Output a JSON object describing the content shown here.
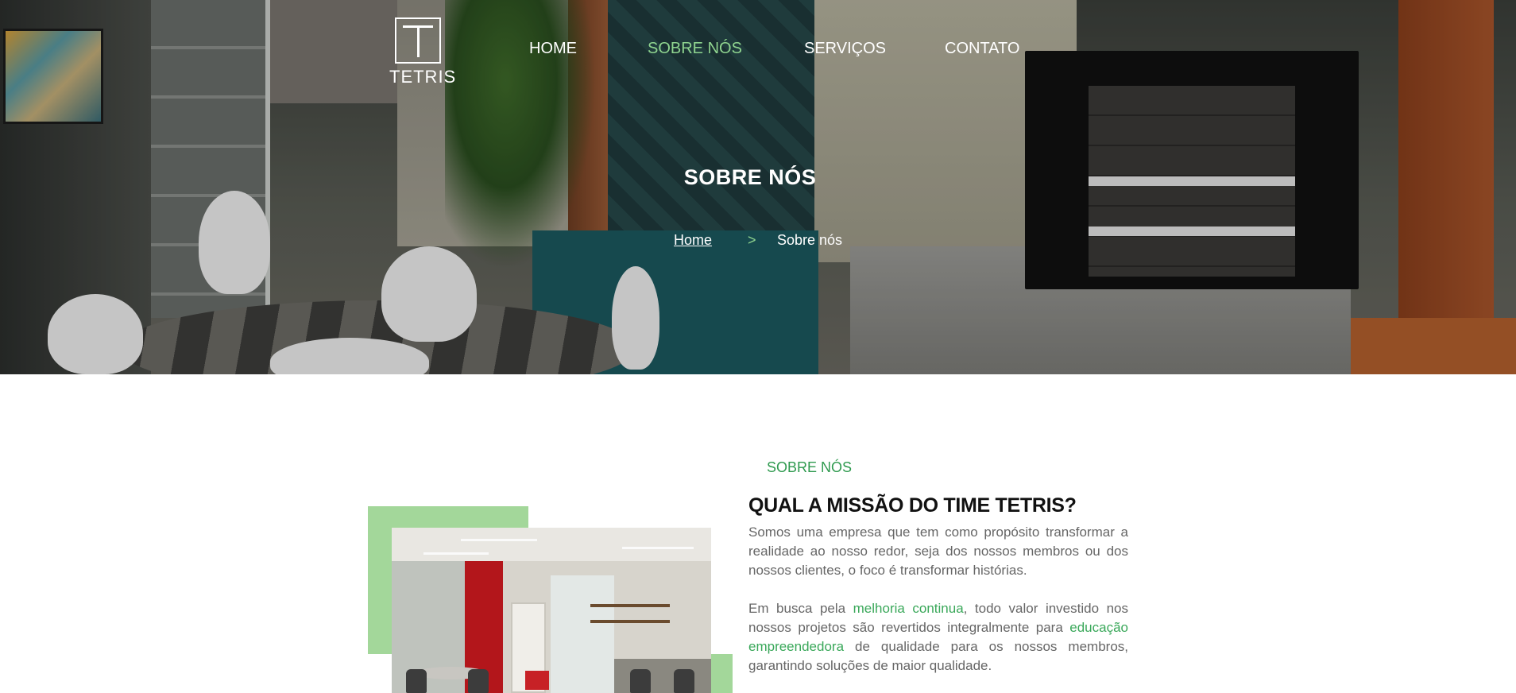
{
  "header": {
    "logo_text": "TETRIS",
    "nav": {
      "home": "HOME",
      "sobre": "SOBRE NÓS",
      "servicos": "SERVIÇOS",
      "contato": "CONTATO"
    }
  },
  "hero": {
    "title": "SOBRE NÓS",
    "breadcrumb": {
      "home": "Home",
      "separator": ">",
      "current": "Sobre nós"
    }
  },
  "about": {
    "label": "SOBRE NÓS",
    "title": "QUAL A MISSÃO DO TIME TETRIS?",
    "paragraph1": "Somos uma empresa que tem como propósito transformar a realidade ao nosso redor, seja dos nossos membros ou dos nossos clientes, o foco é transformar histórias.",
    "paragraph2": {
      "part1": "Em busca pela ",
      "highlight1": "melhoria continua",
      "part2": ", todo valor investido nos nossos projetos são revertidos integralmente para ",
      "highlight2": "educação empreendedora",
      "part3": " de qualidade para os nossos membros, garantindo soluções de maior qualidade."
    }
  },
  "colors": {
    "accent_green": "#8fd48f",
    "label_green": "#2f9a4f",
    "block_green": "#a3d79a",
    "text_gray": "#666666"
  }
}
